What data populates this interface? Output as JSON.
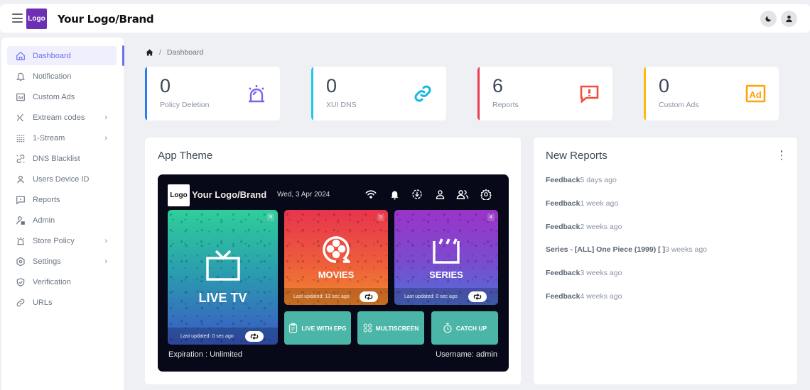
{
  "header": {
    "logo_text": "Logo",
    "brand": "Your Logo/Brand",
    "icons": [
      "menu-icon",
      "moon-icon",
      "user-icon"
    ]
  },
  "sidebar": {
    "items": [
      {
        "label": "Dashboard",
        "icon": "home-icon",
        "active": true,
        "has_submenu": false
      },
      {
        "label": "Notification",
        "icon": "bell-icon",
        "active": false,
        "has_submenu": false
      },
      {
        "label": "Custom Ads",
        "icon": "ad-icon",
        "active": false,
        "has_submenu": false
      },
      {
        "label": "Extream codes",
        "icon": "xtream-icon",
        "active": false,
        "has_submenu": true
      },
      {
        "label": "1-Stream",
        "icon": "stream-icon",
        "active": false,
        "has_submenu": true
      },
      {
        "label": "DNS Blacklist",
        "icon": "link-off-icon",
        "active": false,
        "has_submenu": false
      },
      {
        "label": "Users Device ID",
        "icon": "user-icon",
        "active": false,
        "has_submenu": false
      },
      {
        "label": "Reports",
        "icon": "report-icon",
        "active": false,
        "has_submenu": false
      },
      {
        "label": "Admin",
        "icon": "admin-icon",
        "active": false,
        "has_submenu": false
      },
      {
        "label": "Store Policy",
        "icon": "alarm-icon",
        "active": false,
        "has_submenu": true
      },
      {
        "label": "Settings",
        "icon": "settings-icon",
        "active": false,
        "has_submenu": true
      },
      {
        "label": "Verification",
        "icon": "shield-check-icon",
        "active": false,
        "has_submenu": false
      },
      {
        "label": "URLs",
        "icon": "link-icon",
        "active": false,
        "has_submenu": false
      }
    ],
    "chevron": "›"
  },
  "breadcrumb": {
    "separator": "/",
    "current": "Dashboard"
  },
  "stats": [
    {
      "value": "0",
      "label": "Policy Deletion",
      "color": "#2f7bf5",
      "icon_color": "#7367f0",
      "icon": "siren-icon"
    },
    {
      "value": "0",
      "label": "XUI DNS",
      "color": "#1ec8e6",
      "icon_color": "#1ab7e0",
      "icon": "link-icon"
    },
    {
      "value": "6",
      "label": "Reports",
      "color": "#ea3b4f",
      "icon_color": "#f24e3a",
      "icon": "report-icon"
    },
    {
      "value": "0",
      "label": "Custom Ads",
      "color": "#fdbb0e",
      "icon_color": "#ffa20d",
      "icon": "ad-icon"
    }
  ],
  "app_theme": {
    "title": "App Theme",
    "preview": {
      "logo_text": "Logo",
      "brand": "Your Logo/Brand",
      "date": "Wed, 3 Apr 2024",
      "icons": [
        "wifi-icon",
        "bell-icon",
        "download-icon",
        "profile-icon",
        "users-icon",
        "settings-icon"
      ],
      "tiles": [
        {
          "title": "LIVE TV",
          "count": "9",
          "updated": "Last updated: 0 sec ago",
          "icon": "tv-icon"
        },
        {
          "title": "MOVIES",
          "count": "5",
          "updated": "Last updated: 13 sec ago",
          "icon": "film-reel-icon"
        },
        {
          "title": "SERIES",
          "count": "4",
          "updated": "Last updated: 0 sec ago",
          "icon": "clapperboard-icon"
        }
      ],
      "actions": [
        {
          "label": "LIVE WITH EPG",
          "icon": "clipboard-icon"
        },
        {
          "label": "MULTISCREEN",
          "icon": "grid-icon"
        },
        {
          "label": "CATCH UP",
          "icon": "stopwatch-icon"
        }
      ],
      "expiration": "Expiration :  Unlimited",
      "username": "Username: admin"
    }
  },
  "new_reports": {
    "title": "New Reports",
    "items": [
      {
        "title": "Feedback",
        "time": "5 days ago"
      },
      {
        "title": "Feedback",
        "time": "1 week ago"
      },
      {
        "title": "Feedback",
        "time": "2 weeks ago"
      },
      {
        "title": "Series - [ALL] One Piece (1999) [ ]",
        "time": "3 weeks ago"
      },
      {
        "title": "Feedback",
        "time": "3 weeks ago"
      },
      {
        "title": "Feedback",
        "time": "4 weeks ago"
      }
    ]
  }
}
